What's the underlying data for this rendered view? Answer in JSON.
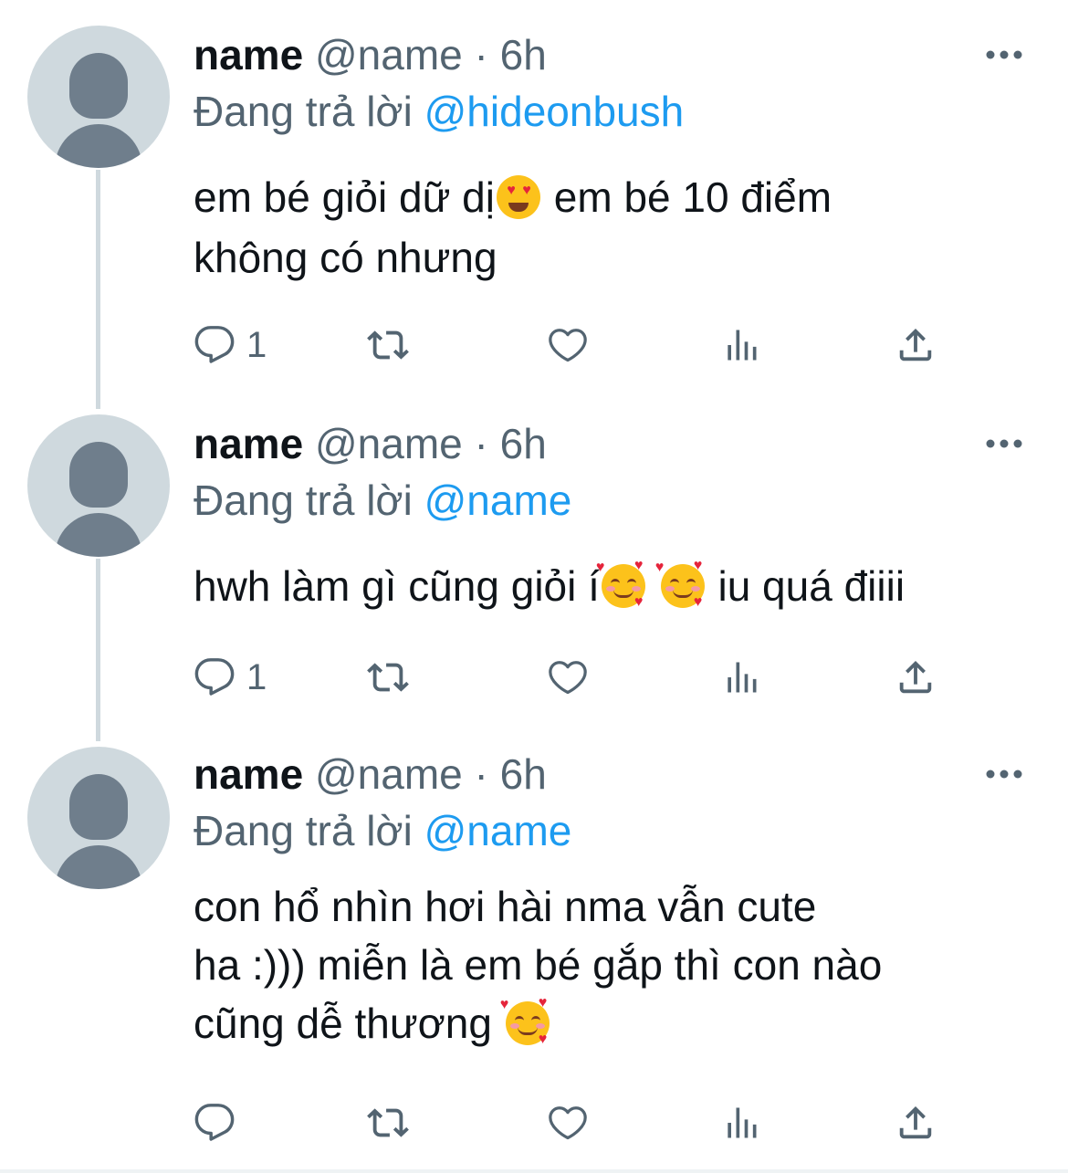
{
  "tweets": [
    {
      "display_name": "name",
      "handle": "@name",
      "separator": "·",
      "time": "6h",
      "replying_prefix": "Đang trả lời",
      "replying_to": "@hideonbush",
      "text_part1": "em bé giỏi dữ dị",
      "text_part2": " em bé 10 điểm\nkhông có nhưng",
      "reply_count": "1"
    },
    {
      "display_name": "name",
      "handle": "@name",
      "separator": "·",
      "time": "6h",
      "replying_prefix": "Đang trả lời",
      "replying_to": "@name",
      "text_part1": "hwh làm gì cũng giỏi í",
      "text_part2": " iu quá điiii",
      "reply_count": "1"
    },
    {
      "display_name": "name",
      "handle": "@name",
      "separator": "·",
      "time": "6h",
      "replying_prefix": "Đang trả lời",
      "replying_to": "@name",
      "text_part1": "con hổ nhìn hơi hài nma vẫn cute\nha :))) miễn là em bé gắp thì con nào\ncũng dễ thương ",
      "reply_count": ""
    }
  ],
  "icons": {
    "avatar": "default-avatar-icon",
    "more": "more-dots-icon",
    "reply": "reply-bubble-icon",
    "retweet": "retweet-icon",
    "like": "heart-icon",
    "views": "bar-chart-icon",
    "share": "share-upload-icon",
    "emoji_1": "smiling-face-with-heart-eyes-emoji",
    "emoji_2": "smiling-face-with-hearts-emoji"
  },
  "colors": {
    "link": "#1d9bf0",
    "secondary_text": "#536471",
    "avatar_bg": "#cfd9de",
    "avatar_fg": "#6f7e8c"
  }
}
